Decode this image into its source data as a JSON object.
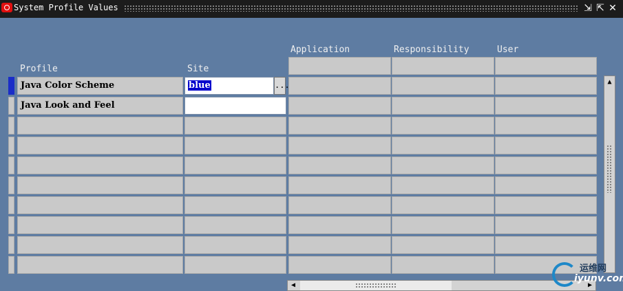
{
  "window": {
    "title": "System Profile Values",
    "buttons": {
      "minimize": "⇲",
      "maximize": "⇱",
      "close": "✕"
    }
  },
  "columns": {
    "profile": "Profile",
    "site": "Site",
    "application": "Application",
    "responsibility": "Responsibility",
    "user": "User"
  },
  "rows": [
    {
      "profile": "Java Color Scheme",
      "site": "blue",
      "application": "",
      "responsibility": "",
      "user": ""
    },
    {
      "profile": "Java Look and Feel",
      "site": "",
      "application": "",
      "responsibility": "",
      "user": ""
    },
    {
      "profile": "",
      "site": "",
      "application": "",
      "responsibility": "",
      "user": ""
    },
    {
      "profile": "",
      "site": "",
      "application": "",
      "responsibility": "",
      "user": ""
    },
    {
      "profile": "",
      "site": "",
      "application": "",
      "responsibility": "",
      "user": ""
    },
    {
      "profile": "",
      "site": "",
      "application": "",
      "responsibility": "",
      "user": ""
    },
    {
      "profile": "",
      "site": "",
      "application": "",
      "responsibility": "",
      "user": ""
    },
    {
      "profile": "",
      "site": "",
      "application": "",
      "responsibility": "",
      "user": ""
    },
    {
      "profile": "",
      "site": "",
      "application": "",
      "responsibility": "",
      "user": ""
    },
    {
      "profile": "",
      "site": "",
      "application": "",
      "responsibility": "",
      "user": ""
    }
  ],
  "lov_button": "...",
  "watermark": {
    "top": "运维网",
    "bottom": "iyunv.com"
  },
  "colors": {
    "background": "#5e7ca2",
    "cell": "#c9c9c9",
    "selection": "#0000cc",
    "active_row": "#1a2dc8"
  }
}
